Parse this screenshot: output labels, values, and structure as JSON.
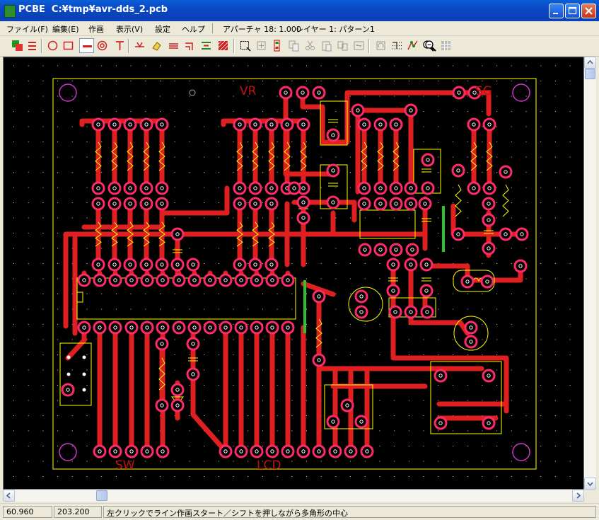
{
  "window": {
    "app_name": "PCBE",
    "file_path": "C:¥tmp¥avr-dds_2.pcb"
  },
  "menu": [
    {
      "label": "ファイル(F)",
      "name": "menu-file"
    },
    {
      "label": "編集(E)",
      "name": "menu-edit"
    },
    {
      "label": "作画",
      "name": "menu-draw"
    },
    {
      "label": "表示(V)",
      "name": "menu-view"
    },
    {
      "label": "設定",
      "name": "menu-settings"
    },
    {
      "label": "ヘルプ",
      "name": "menu-help"
    }
  ],
  "menu_status": {
    "aperture": "アパーチャ 18: 1.000",
    "layer": "レイヤー 1: パターン1"
  },
  "toolbar": [
    {
      "icon": "layers-icon",
      "pressed": false
    },
    {
      "icon": "layer-switch-icon",
      "pressed": false
    },
    {
      "icon": "circle-tool-icon",
      "pressed": false
    },
    {
      "icon": "rectangle-tool-icon",
      "pressed": false
    },
    {
      "icon": "line-tool-icon",
      "pressed": true
    },
    {
      "icon": "pad-tool-icon",
      "pressed": false
    },
    {
      "icon": "text-tool-icon",
      "pressed": false
    },
    {
      "icon": "junction-icon",
      "pressed": false
    },
    {
      "icon": "eraser-icon",
      "pressed": false
    },
    {
      "icon": "bus-line-icon",
      "pressed": false
    },
    {
      "icon": "corner-line-icon",
      "pressed": false
    },
    {
      "icon": "align-icon",
      "pressed": false
    },
    {
      "icon": "fill-area-icon",
      "pressed": false
    },
    {
      "icon": "select-area-icon",
      "pressed": false
    },
    {
      "icon": "move-icon",
      "pressed": false
    },
    {
      "icon": "component-icon",
      "pressed": false
    },
    {
      "icon": "copy-icon",
      "pressed": false
    },
    {
      "icon": "cut-icon",
      "pressed": false
    },
    {
      "icon": "paste-icon",
      "pressed": false
    },
    {
      "icon": "duplicate-icon",
      "pressed": false
    },
    {
      "icon": "mirror-icon",
      "pressed": false
    },
    {
      "icon": "rotate-icon",
      "pressed": false
    },
    {
      "icon": "grid-toggle-icon",
      "pressed": false
    },
    {
      "icon": "route-icon",
      "pressed": false
    },
    {
      "icon": "zoom-in-icon",
      "pressed": false
    },
    {
      "icon": "zoom-out-icon",
      "pressed": false
    },
    {
      "icon": "fit-view-icon",
      "pressed": false
    }
  ],
  "board": {
    "silk_labels": [
      "VR",
      "SG",
      "SW",
      "LCD"
    ],
    "colors": {
      "background": "#000000",
      "trace": "#e02020",
      "pad": "#ff2a6a",
      "silk": "#ffff00",
      "outline": "#d9d900",
      "mount": "#cc33cc",
      "grid": "#d0d0d0",
      "label": "#c01010"
    }
  },
  "status": {
    "x": "60.960",
    "y": "203.200",
    "message": "左クリックでライン作画スタート／シフトを押しながら多角形の中心"
  }
}
